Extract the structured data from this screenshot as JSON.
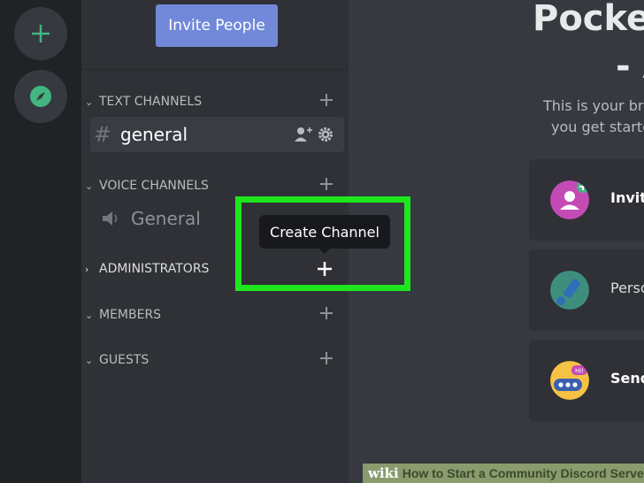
{
  "sidebar": {
    "invite_button": "Invite People",
    "categories": {
      "text": "TEXT CHANNELS",
      "voice": "VOICE CHANNELS",
      "admins": "ADMINISTRATORS",
      "members": "MEMBERS",
      "guests": "GUESTS"
    },
    "channels": {
      "text_general": "general",
      "voice_general": "General"
    }
  },
  "tooltip": {
    "text": "Create Channel"
  },
  "main": {
    "title_line1": "Pockettu",
    "title_line2": "- A",
    "intro_line1": "This is your bra",
    "intro_line2": "you get starteo",
    "cards": [
      {
        "label": "Invite",
        "icon": "invite-icon"
      },
      {
        "label": "Perso",
        "icon": "personalize-icon"
      },
      {
        "label": "Send",
        "icon": "send-icon"
      }
    ]
  },
  "watermark": {
    "brand": "wiki",
    "title": "How to Start a Community Discord Server"
  },
  "colors": {
    "highlight": "#1ee61e",
    "blurple": "#7289da",
    "green": "#43b581"
  }
}
